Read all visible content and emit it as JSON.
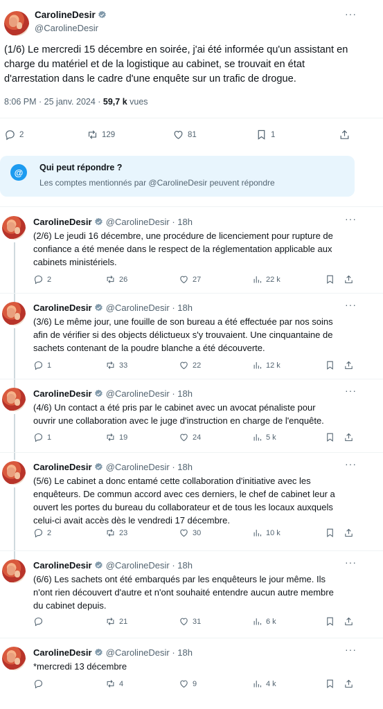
{
  "main": {
    "display_name": "CarolineDesir",
    "username": "@CarolineDesir",
    "text": "(1/6) Le mercredi 15 décembre en soirée, j'ai été informée qu'un assistant en charge du matériel et de la logistique au cabinet, se trouvait en état d'arrestation dans le cadre d'une enquête sur un trafic de drogue.",
    "time": "8:06 PM · 25 janv. 2024 · ",
    "views": "59,7 k",
    "views_label": " vues",
    "more": "···",
    "replies": "2",
    "reposts": "129",
    "likes": "81",
    "bookmarks": "1"
  },
  "reply_notice": {
    "icon": "@",
    "title": "Qui peut répondre ?",
    "description": "Les comptes mentionnés par @CarolineDesir peuvent répondre"
  },
  "thread": [
    {
      "name": "CarolineDesir",
      "meta": "@CarolineDesir · 18h",
      "text": "(2/6) Le jeudi 16 décembre, une procédure de licenciement pour rupture de confiance a été menée dans le respect de la réglementation applicable aux cabinets ministériels.",
      "replies": "2",
      "reposts": "26",
      "likes": "27",
      "views": "22 k"
    },
    {
      "name": "CarolineDesir",
      "meta": "@CarolineDesir · 18h",
      "text": "(3/6) Le même jour, une fouille de son bureau a été effectuée par nos soins afin de vérifier si des objects délictueux s'y trouvaient. Une cinquantaine de sachets contenant de la poudre blanche a été découverte.",
      "replies": "1",
      "reposts": "33",
      "likes": "22",
      "views": "12 k"
    },
    {
      "name": "CarolineDesir",
      "meta": "@CarolineDesir · 18h",
      "text": "(4/6) Un contact a été pris par le cabinet avec un avocat pénaliste pour ouvrir une collaboration avec le juge d'instruction en charge de l'enquête.",
      "replies": "1",
      "reposts": "19",
      "likes": "24",
      "views": "5 k"
    },
    {
      "name": "CarolineDesir",
      "meta": "@CarolineDesir · 18h",
      "text": "(5/6) Le cabinet a donc entamé cette collaboration d'initiative avec les enquêteurs. De commun accord avec ces derniers, le chef de cabinet leur a ouvert les portes du bureau du collaborateur et de tous les locaux auxquels celui-ci avait accès dès le vendredi 17 décembre.",
      "replies": "2",
      "reposts": "23",
      "likes": "30",
      "views": "10 k"
    },
    {
      "name": "CarolineDesir",
      "meta": "@CarolineDesir · 18h",
      "text": "(6/6) Les sachets ont été embarqués par les enquêteurs le jour même. Ils n'ont rien découvert d'autre et n'ont souhaité entendre aucun autre membre du cabinet depuis.",
      "replies": "",
      "reposts": "21",
      "likes": "31",
      "views": "6 k"
    },
    {
      "name": "CarolineDesir",
      "meta": "@CarolineDesir · 18h",
      "text": "*mercredi 13 décembre",
      "replies": "",
      "reposts": "4",
      "likes": "9",
      "views": "4 k"
    }
  ],
  "colors": {
    "accent": "#1d9bf0",
    "muted": "#536471",
    "notice_bg": "#e8f5fd"
  },
  "icons": [
    "verified-badge-icon",
    "reply-icon",
    "repost-icon",
    "like-icon",
    "views-icon",
    "bookmark-icon",
    "share-icon",
    "more-icon",
    "mention-icon"
  ]
}
